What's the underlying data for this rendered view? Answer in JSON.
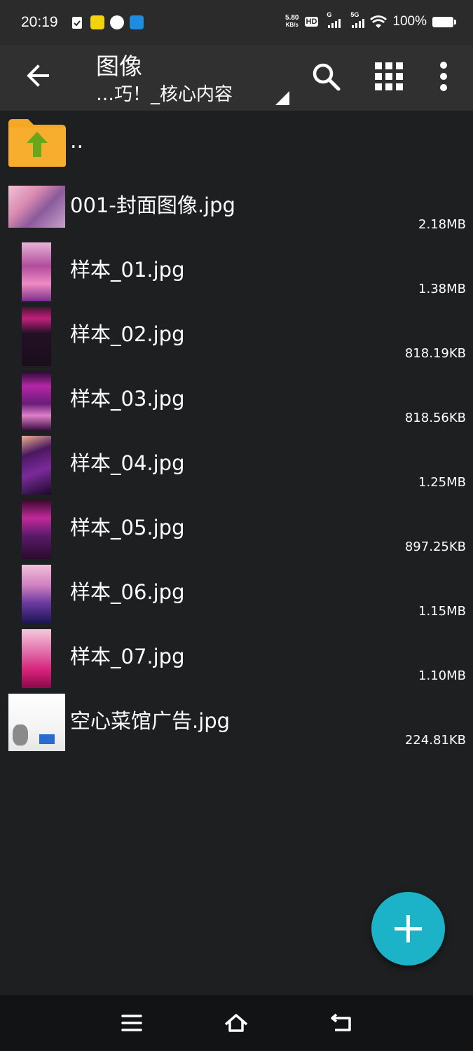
{
  "status": {
    "time": "20:19",
    "net_speed_value": "5.80",
    "net_speed_unit": "KB/s",
    "hd_label": "HD",
    "sig1_label": "G",
    "sig2_label": "5G",
    "battery_pct": "100%"
  },
  "toolbar": {
    "title": "图像",
    "subtitle": "…巧！_核心内容",
    "icons": [
      "back-arrow-icon",
      "search-icon",
      "grid-view-icon",
      "more-vert-icon"
    ]
  },
  "files": {
    "parent": {
      "name": ".."
    },
    "items": [
      {
        "name": "001-封面图像.jpg",
        "size": "2.18MB"
      },
      {
        "name": "样本_01.jpg",
        "size": "1.38MB"
      },
      {
        "name": "样本_02.jpg",
        "size": "818.19KB"
      },
      {
        "name": "样本_03.jpg",
        "size": "818.56KB"
      },
      {
        "name": "样本_04.jpg",
        "size": "1.25MB"
      },
      {
        "name": "样本_05.jpg",
        "size": "897.25KB"
      },
      {
        "name": "样本_06.jpg",
        "size": "1.15MB"
      },
      {
        "name": "样本_07.jpg",
        "size": "1.10MB"
      },
      {
        "name": "空心菜馆广告.jpg",
        "size": "224.81KB"
      }
    ]
  },
  "colors": {
    "background": "#1d1f21",
    "toolbar": "#303030",
    "fab": "#1cb3c8",
    "folder": "#f5a623",
    "arrow": "#6aa61c"
  }
}
